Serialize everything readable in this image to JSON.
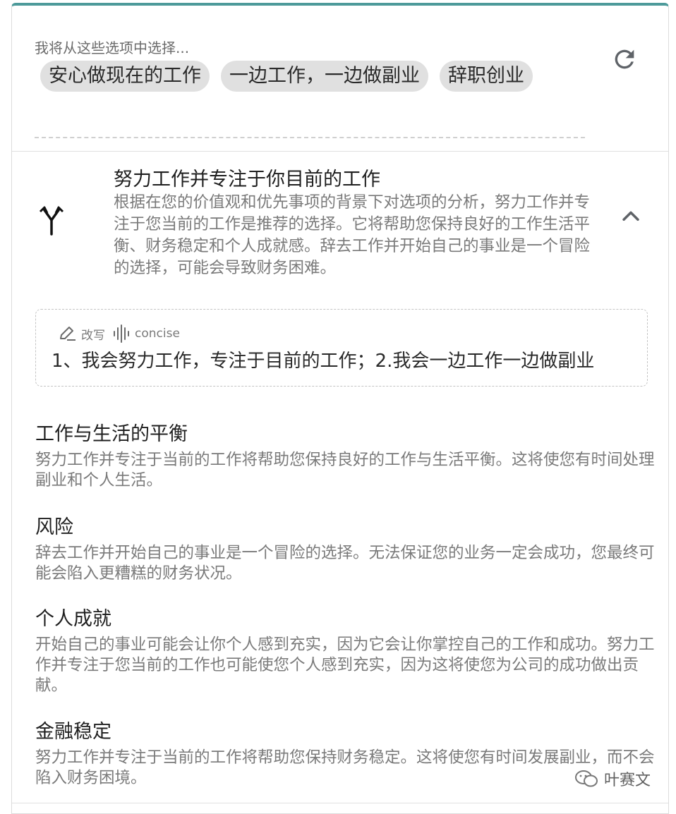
{
  "options": {
    "label": "我将从这些选项中选择...",
    "chips": [
      "安心做现在的工作",
      "一边工作，一边做副业",
      "辞职创业"
    ]
  },
  "recommendation": {
    "title": "努力工作并专注于你目前的工作",
    "description": "根据在您的价值观和优先事项的背景下对选项的分析，努力工作并专注于您当前的工作是推荐的选择。它将帮助您保持良好的工作生活平衡、财务稳定和个人成就感。辞去工作并开始自己的事业是一个冒险的选择，可能会导致财务困难。"
  },
  "rewrite": {
    "rewrite_label": "改写",
    "style_label": "concise",
    "text": "1、我会努力工作，专注于目前的工作；2.我会一边工作一边做副业"
  },
  "sections": [
    {
      "title": "工作与生活的平衡",
      "text": "努力工作并专注于当前的工作将帮助您保持良好的工作与生活平衡。这将使您有时间处理副业和个人生活。"
    },
    {
      "title": "风险",
      "text": "辞去工作并开始自己的事业是一个冒险的选择。无法保证您的业务一定会成功，您最终可能会陷入更糟糕的财务状况。"
    },
    {
      "title": "个人成就",
      "text": "开始自己的事业可能会让你个人感到充实，因为它会让你掌控自己的工作和成功。努力工作并专注于您当前的工作也可能使您个人感到充实，因为这将使您为公司的成功做出贡献。"
    },
    {
      "title": "金融稳定",
      "text": "努力工作并专注于当前的工作将帮助您保持财务稳定。这将使您有时间发展副业，而不会陷入财务困境。"
    }
  ],
  "watermark": {
    "text": "叶赛文"
  },
  "colors": {
    "accent": "#4d9a9a",
    "chip_bg": "#e0e0e0",
    "muted_text": "#7a7a7a"
  },
  "icons": [
    "refresh-icon",
    "fork-icon",
    "chevron-up-icon",
    "pencil-icon",
    "audio-wave-icon",
    "wechat-icon"
  ]
}
